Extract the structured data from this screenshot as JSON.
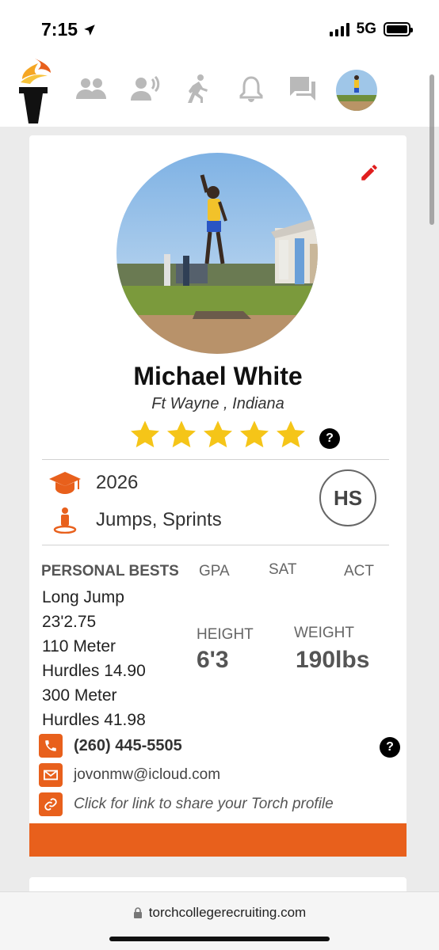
{
  "status_bar": {
    "time": "7:15",
    "network": "5G"
  },
  "nav": {
    "logo": "torch-logo",
    "icons": [
      "recruits-icon",
      "announcements-icon",
      "activity-icon",
      "notifications-icon",
      "messages-icon",
      "profile-avatar"
    ]
  },
  "profile": {
    "first_name": "Michael",
    "last_name": "White",
    "full_name": "Michael  White",
    "location": "Ft Wayne , Indiana",
    "rating": 5,
    "rating_max": 5,
    "help_label": "?",
    "grad_year": "2026",
    "events": "Jumps, Sprints",
    "level_badge": "HS"
  },
  "stats": {
    "personal_bests_label": "PERSONAL BESTS",
    "gpa_label": "GPA",
    "sat_label": "SAT",
    "act_label": "ACT",
    "height_label": "HEIGHT",
    "height_value": "6'3",
    "weight_label": "WEIGHT",
    "weight_value": "190lbs",
    "personal_bests": [
      "Long Jump",
      "23'2.75",
      "110 Meter",
      "Hurdles  14.90",
      "300 Meter",
      "Hurdles  41.98"
    ]
  },
  "contact": {
    "phone": "(260) 445-5505",
    "email": "jovonmw@icloud.com",
    "share_text": "Click for link to share your Torch profile",
    "help_label": "?"
  },
  "browser": {
    "url": "torchcollegerecruiting.com"
  },
  "colors": {
    "accent": "#e8601c",
    "star": "#f5c518",
    "edit": "#e01e1e"
  }
}
